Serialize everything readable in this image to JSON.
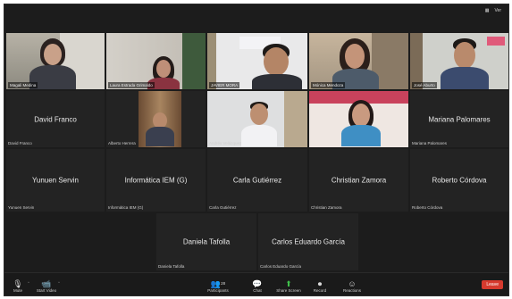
{
  "window": {
    "view_label": "Ver",
    "view_icon": "grid-icon"
  },
  "row1": [
    {
      "name": "Magali Medina"
    },
    {
      "name": "Laura Estrada Grimaldo"
    },
    {
      "name": "JAVIER MORA"
    },
    {
      "name": "Mónica Mendoza"
    },
    {
      "name": "José Aburto"
    }
  ],
  "row2": [
    {
      "big": "David Franco",
      "tag": "David Franco"
    },
    {
      "tag": "Alberto Herrera"
    },
    {
      "tag": "Andrés Velázquez"
    },
    {
      "tag": ""
    },
    {
      "big": "Mariana Palomares",
      "tag": "Mariana Palomares"
    }
  ],
  "row3": [
    {
      "big": "Yunuen Servin",
      "tag": "Yunuen Servin"
    },
    {
      "big": "Informática IEM (G)",
      "tag": "Informática IEM (G)"
    },
    {
      "big": "Carla Gutiérrez",
      "tag": "Carla Gutiérrez"
    },
    {
      "big": "Christian Zamora",
      "tag": "Christian Zamora"
    },
    {
      "big": "Roberto Córdova",
      "tag": "Roberto Córdova"
    }
  ],
  "row4": [
    {
      "big": "Daniela Tafolla",
      "tag": "Daniela Tafolla"
    },
    {
      "big": "Carlos Eduardo García",
      "tag": "Carlos Eduardo García"
    }
  ],
  "toolbar": {
    "mute_label": "Mute",
    "video_label": "Start Video",
    "participants_label": "Participants",
    "participants_count": "28",
    "chat_label": "Chat",
    "share_label": "Share Screen",
    "record_label": "Record",
    "reactions_label": "Reactions",
    "end_label": "Leave"
  },
  "colors": {
    "end_button": "#d63a2e",
    "share_icon": "#3fbf4a"
  }
}
